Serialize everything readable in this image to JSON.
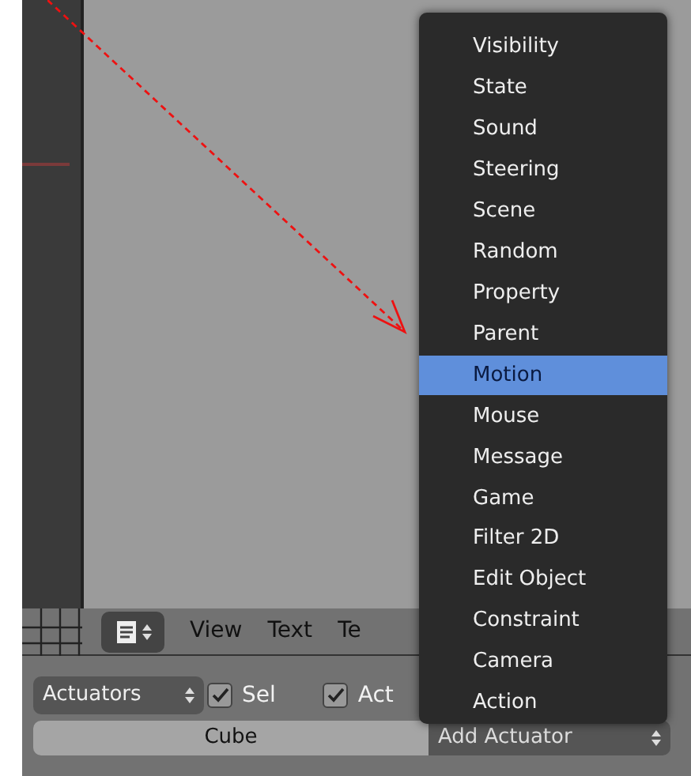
{
  "header": {
    "menus": [
      "View",
      "Text",
      "Te"
    ]
  },
  "logic_bar": {
    "dropdown": "Actuators",
    "checks": [
      {
        "label": "Sel",
        "checked": true
      },
      {
        "label": "Act",
        "checked": true
      }
    ],
    "object_button": "Cube",
    "add_dropdown": "Add Actuator"
  },
  "menu": {
    "items": [
      {
        "label": "Visibility",
        "selected": false
      },
      {
        "label": "State",
        "selected": false
      },
      {
        "label": "Sound",
        "selected": false
      },
      {
        "label": "Steering",
        "selected": false
      },
      {
        "label": "Scene",
        "selected": false
      },
      {
        "label": "Random",
        "selected": false
      },
      {
        "label": "Property",
        "selected": false
      },
      {
        "label": "Parent",
        "selected": false
      },
      {
        "label": "Motion",
        "selected": true
      },
      {
        "label": "Mouse",
        "selected": false
      },
      {
        "label": "Message",
        "selected": false
      },
      {
        "label": "Game",
        "selected": false
      },
      {
        "label": "Filter 2D",
        "selected": false
      },
      {
        "label": "Edit Object",
        "selected": false
      },
      {
        "label": "Constraint",
        "selected": false
      },
      {
        "label": "Camera",
        "selected": false
      },
      {
        "label": "Action",
        "selected": false
      }
    ]
  }
}
